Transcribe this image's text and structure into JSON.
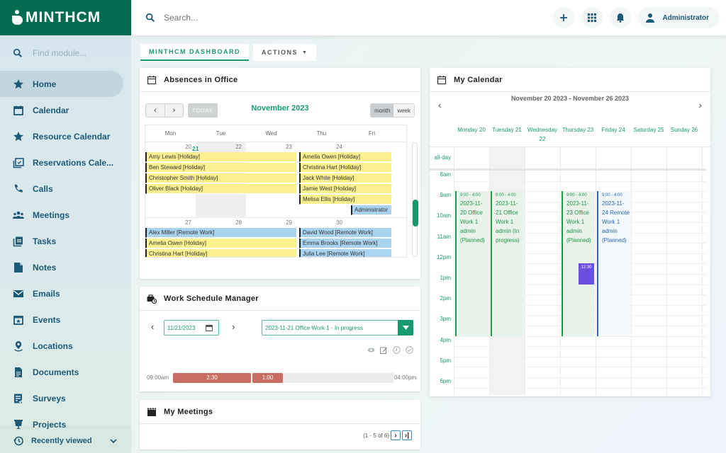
{
  "app": {
    "brand": "MINTHCM"
  },
  "sidebar": {
    "find_placeholder": "Find module...",
    "items": [
      {
        "label": "Home",
        "icon": "star-icon",
        "active": true
      },
      {
        "label": "Calendar",
        "icon": "calendar-icon"
      },
      {
        "label": "Resource Calendar",
        "icon": "star-icon"
      },
      {
        "label": "Reservations Cale...",
        "icon": "calendar-check-icon"
      },
      {
        "label": "Calls",
        "icon": "phone-icon"
      },
      {
        "label": "Meetings",
        "icon": "people-icon"
      },
      {
        "label": "Tasks",
        "icon": "clipboard-icon"
      },
      {
        "label": "Notes",
        "icon": "note-icon"
      },
      {
        "label": "Emails",
        "icon": "mail-icon"
      },
      {
        "label": "Events",
        "icon": "calendar-star-icon"
      },
      {
        "label": "Locations",
        "icon": "location-pin-icon"
      },
      {
        "label": "Documents",
        "icon": "document-icon"
      },
      {
        "label": "Surveys",
        "icon": "survey-icon"
      },
      {
        "label": "Projects",
        "icon": "presentation-icon"
      }
    ],
    "recently_viewed": "Recently viewed"
  },
  "topbar": {
    "search_placeholder": "Search...",
    "user": "Administrator"
  },
  "tabs": [
    {
      "label": "MINTHCM DASHBOARD",
      "active": true
    },
    {
      "label": "ACTIONS"
    }
  ],
  "absences": {
    "title": "Absences in Office",
    "today_label": "TODAY",
    "month_title": "November 2023",
    "views": [
      "month",
      "week"
    ],
    "active_view": "month",
    "weekdays": [
      "Mon",
      "Tue",
      "Wed",
      "Thu",
      "Fri"
    ],
    "weeks": [
      {
        "days": [
          "20",
          "21",
          "22",
          "23",
          "24"
        ],
        "today_index": 1
      },
      {
        "days": [
          "27",
          "28",
          "29",
          "30",
          ""
        ]
      }
    ],
    "events_week1_left": [
      "Amy Lewis [Holiday]",
      "Ben Steward [Holiday]",
      "Christopher Smith [Holiday]",
      "Oliver Black [Holiday]"
    ],
    "events_week1_right": [
      "Amelia Owen [Holiday]",
      "Christina Hart [Holiday]",
      "Jack White [Holiday]",
      "Jamie West [Holiday]",
      "Melisa Ellis [Holiday]"
    ],
    "events_week1_admin": "Administrator",
    "events_week2_left": [
      {
        "label": "Alex Miller [Remote Work]",
        "type": "remote"
      },
      {
        "label": "Amelia Owen [Holiday]",
        "type": "holiday"
      },
      {
        "label": "Christina Hart [Holiday]",
        "type": "holiday"
      }
    ],
    "events_week2_right": [
      {
        "label": "David Wood [Remote Work]",
        "type": "remote"
      },
      {
        "label": "Emma Brooks [Remote Work]",
        "type": "remote"
      },
      {
        "label": "Julia Lee [Remote Work]",
        "type": "remote"
      }
    ]
  },
  "work_schedule": {
    "title": "Work Schedule Manager",
    "date": "11/21/2023",
    "selected": "2023-11-21 Office Work 1 - In progress",
    "start": "09:00am",
    "end": "04:00pm",
    "segments": [
      {
        "label": "2:30"
      },
      {
        "label": "1:00"
      }
    ]
  },
  "meetings": {
    "title": "My Meetings",
    "pager": "(1 - 5 of 6)"
  },
  "my_calendar": {
    "title": "My Calendar",
    "range": "November 20 2023 - November 26 2023",
    "days": [
      "Monday 20",
      "Tuesday 21",
      "Wednesday 22",
      "Thursday 23",
      "Friday 24",
      "Saturday 25",
      "Sunday 26"
    ],
    "allday_label": "all-day",
    "hours": [
      "8am",
      "9am",
      "10am",
      "11am",
      "12pm",
      "1pm",
      "2pm",
      "3pm",
      "4pm",
      "5pm",
      "6pm"
    ],
    "events": [
      {
        "day": 0,
        "time": "9:00 - 4:00",
        "text": "2023-11-20 Office Work 1 admin (Planned)",
        "type": "office"
      },
      {
        "day": 1,
        "time": "9:00 - 4:00",
        "text": "2023-11-21 Office Work 1 admin (In progress)",
        "type": "office"
      },
      {
        "day": 3,
        "time": "9:00 - 4:00",
        "text": "2023-11-23 Office Work 1 admin (Planned)",
        "type": "office"
      },
      {
        "day": 4,
        "time": "9:00 - 4:00",
        "text": "2023-11-24 Remote Work 1 admin (Planned)",
        "type": "remote"
      }
    ],
    "mini_event": "12:30"
  },
  "colors": {
    "brand": "#006b4f",
    "accent": "#1a9a70",
    "holiday": "#fbf28f",
    "remote": "#a9d3ef",
    "segment": "#c96d61",
    "mini": "#6b4fe0"
  }
}
